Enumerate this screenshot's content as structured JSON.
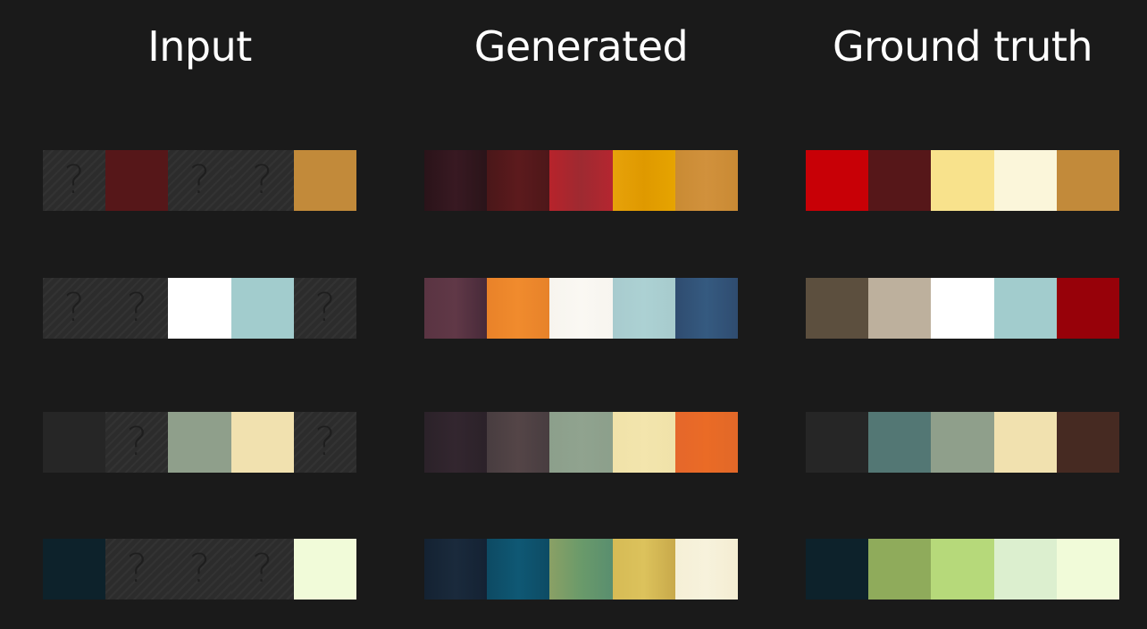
{
  "columns": {
    "input": "Input",
    "generated": "Generated",
    "ground_truth": "Ground truth"
  },
  "unknown_symbol": "?",
  "palettes": [
    {
      "input": [
        null,
        "#561719",
        null,
        null,
        "#c28a3a"
      ],
      "generated": [
        [
          "#2a1319",
          "#381922",
          "#2a1419"
        ],
        [
          "#4a1719",
          "#5c1a1d",
          "#4d1719"
        ],
        [
          "#b7232b",
          "#9e2a31",
          "#b52630"
        ],
        [
          "#e7a20a",
          "#df9900",
          "#e6a400"
        ],
        [
          "#c98b34",
          "#d1913c",
          "#c98a34"
        ]
      ],
      "ground_truth": [
        "#c80006",
        "#561719",
        "#f8e28c",
        "#fbf6da",
        "#c28a3a"
      ]
    },
    {
      "input": [
        null,
        null,
        "#ffffff",
        "#a2cccd",
        null
      ],
      "generated": [
        [
          "#5a3442",
          "#603847",
          "#472a39"
        ],
        [
          "#e98229",
          "#f08b2d",
          "#e7822a"
        ],
        [
          "#f7f4ee",
          "#faf8f3",
          "#f7f5ef"
        ],
        [
          "#a8cbce",
          "#acd1d3",
          "#a7cbcd"
        ],
        [
          "#2f4c70",
          "#355a80",
          "#2f4c70"
        ]
      ],
      "ground_truth": [
        "#5c4f3e",
        "#bdb09d",
        "#ffffff",
        "#a2cccd",
        "#970109"
      ]
    },
    {
      "input": [
        "#262626",
        null,
        "#8f9f8b",
        "#f1e1af",
        null
      ],
      "generated": [
        [
          "#2b2229",
          "#33262f",
          "#2b2229"
        ],
        [
          "#483d40",
          "#544547",
          "#483d40"
        ],
        [
          "#8c9f8b",
          "#90a38f",
          "#8c9f8b"
        ],
        [
          "#f0e2a9",
          "#f3e5ad",
          "#f0e2a9"
        ],
        [
          "#e5672b",
          "#ea6b26",
          "#e16828"
        ]
      ],
      "ground_truth": [
        "#262626",
        "#537774",
        "#8f9f8b",
        "#f1e1af",
        "#462a22"
      ]
    },
    {
      "input": [
        "#0d222b",
        null,
        null,
        null,
        "#f1fbd9"
      ],
      "generated": [
        [
          "#142232",
          "#1a2a3c",
          "#142233"
        ],
        [
          "#0d4a63",
          "#0f5874",
          "#0d4b64"
        ],
        [
          "#8aa065",
          "#6a9a6a",
          "#598e6f"
        ],
        [
          "#d6bb55",
          "#dcc25c",
          "#c8a94a"
        ],
        [
          "#f5efd6",
          "#f7f2dc",
          "#f4edd2"
        ]
      ],
      "ground_truth": [
        "#0d222b",
        "#8fab5b",
        "#b6d97a",
        "#dcefcf",
        "#f1fbd9"
      ]
    }
  ]
}
